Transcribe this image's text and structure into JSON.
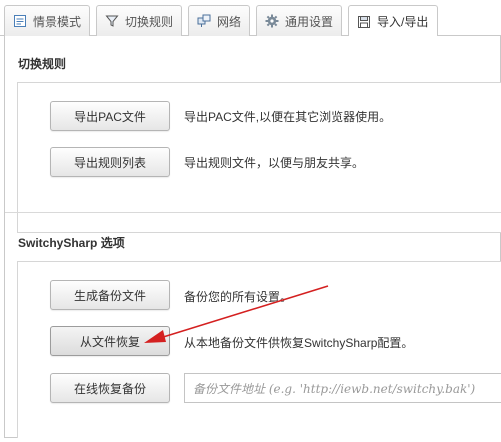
{
  "tabs": [
    {
      "label": "情景模式",
      "icon": "list-icon"
    },
    {
      "label": "切换规则",
      "icon": "filter-icon"
    },
    {
      "label": "网络",
      "icon": "network-icon"
    },
    {
      "label": "通用设置",
      "icon": "gear-icon"
    },
    {
      "label": "导入/导出",
      "icon": "save-icon",
      "active": true
    }
  ],
  "switch_rules": {
    "title": "切换规则",
    "export_pac_button": "导出PAC文件",
    "export_pac_desc": "导出PAC文件,以便在其它浏览器使用。",
    "export_rules_button": "导出规则列表",
    "export_rules_desc": "导出规则文件，以便与朋友共享。"
  },
  "switchysharp_options": {
    "title": "SwitchySharp 选项",
    "create_backup_button": "生成备份文件",
    "create_backup_desc": "备份您的所有设置。",
    "restore_file_button": "从文件恢复",
    "restore_file_desc": "从本地备份文件供恢复SwitchySharp配置。",
    "restore_online_button": "在线恢复备份",
    "backup_url_placeholder": "备份文件地址 (e.g. 'http://iewb.net/switchy.bak')"
  },
  "colors": {
    "annotation_arrow": "#d42020",
    "border": "#c9c9c9"
  }
}
